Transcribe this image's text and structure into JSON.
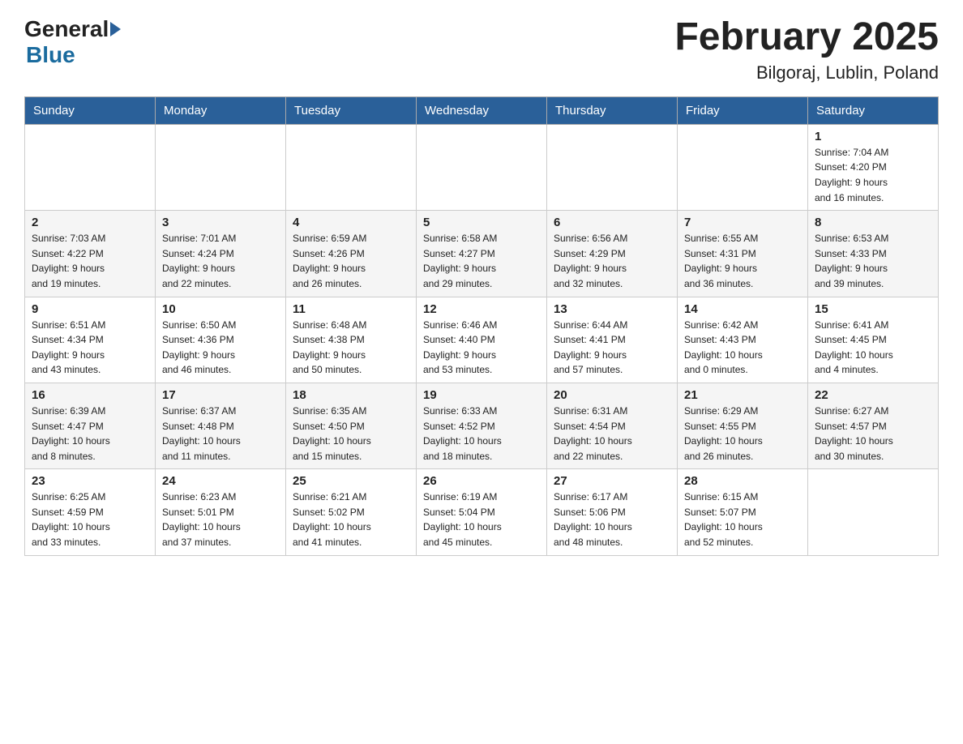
{
  "header": {
    "logo_general": "General",
    "logo_blue": "Blue",
    "title": "February 2025",
    "subtitle": "Bilgoraj, Lublin, Poland"
  },
  "days_of_week": [
    "Sunday",
    "Monday",
    "Tuesday",
    "Wednesday",
    "Thursday",
    "Friday",
    "Saturday"
  ],
  "weeks": [
    {
      "days": [
        {
          "number": "",
          "info": ""
        },
        {
          "number": "",
          "info": ""
        },
        {
          "number": "",
          "info": ""
        },
        {
          "number": "",
          "info": ""
        },
        {
          "number": "",
          "info": ""
        },
        {
          "number": "",
          "info": ""
        },
        {
          "number": "1",
          "info": "Sunrise: 7:04 AM\nSunset: 4:20 PM\nDaylight: 9 hours\nand 16 minutes."
        }
      ]
    },
    {
      "days": [
        {
          "number": "2",
          "info": "Sunrise: 7:03 AM\nSunset: 4:22 PM\nDaylight: 9 hours\nand 19 minutes."
        },
        {
          "number": "3",
          "info": "Sunrise: 7:01 AM\nSunset: 4:24 PM\nDaylight: 9 hours\nand 22 minutes."
        },
        {
          "number": "4",
          "info": "Sunrise: 6:59 AM\nSunset: 4:26 PM\nDaylight: 9 hours\nand 26 minutes."
        },
        {
          "number": "5",
          "info": "Sunrise: 6:58 AM\nSunset: 4:27 PM\nDaylight: 9 hours\nand 29 minutes."
        },
        {
          "number": "6",
          "info": "Sunrise: 6:56 AM\nSunset: 4:29 PM\nDaylight: 9 hours\nand 32 minutes."
        },
        {
          "number": "7",
          "info": "Sunrise: 6:55 AM\nSunset: 4:31 PM\nDaylight: 9 hours\nand 36 minutes."
        },
        {
          "number": "8",
          "info": "Sunrise: 6:53 AM\nSunset: 4:33 PM\nDaylight: 9 hours\nand 39 minutes."
        }
      ]
    },
    {
      "days": [
        {
          "number": "9",
          "info": "Sunrise: 6:51 AM\nSunset: 4:34 PM\nDaylight: 9 hours\nand 43 minutes."
        },
        {
          "number": "10",
          "info": "Sunrise: 6:50 AM\nSunset: 4:36 PM\nDaylight: 9 hours\nand 46 minutes."
        },
        {
          "number": "11",
          "info": "Sunrise: 6:48 AM\nSunset: 4:38 PM\nDaylight: 9 hours\nand 50 minutes."
        },
        {
          "number": "12",
          "info": "Sunrise: 6:46 AM\nSunset: 4:40 PM\nDaylight: 9 hours\nand 53 minutes."
        },
        {
          "number": "13",
          "info": "Sunrise: 6:44 AM\nSunset: 4:41 PM\nDaylight: 9 hours\nand 57 minutes."
        },
        {
          "number": "14",
          "info": "Sunrise: 6:42 AM\nSunset: 4:43 PM\nDaylight: 10 hours\nand 0 minutes."
        },
        {
          "number": "15",
          "info": "Sunrise: 6:41 AM\nSunset: 4:45 PM\nDaylight: 10 hours\nand 4 minutes."
        }
      ]
    },
    {
      "days": [
        {
          "number": "16",
          "info": "Sunrise: 6:39 AM\nSunset: 4:47 PM\nDaylight: 10 hours\nand 8 minutes."
        },
        {
          "number": "17",
          "info": "Sunrise: 6:37 AM\nSunset: 4:48 PM\nDaylight: 10 hours\nand 11 minutes."
        },
        {
          "number": "18",
          "info": "Sunrise: 6:35 AM\nSunset: 4:50 PM\nDaylight: 10 hours\nand 15 minutes."
        },
        {
          "number": "19",
          "info": "Sunrise: 6:33 AM\nSunset: 4:52 PM\nDaylight: 10 hours\nand 18 minutes."
        },
        {
          "number": "20",
          "info": "Sunrise: 6:31 AM\nSunset: 4:54 PM\nDaylight: 10 hours\nand 22 minutes."
        },
        {
          "number": "21",
          "info": "Sunrise: 6:29 AM\nSunset: 4:55 PM\nDaylight: 10 hours\nand 26 minutes."
        },
        {
          "number": "22",
          "info": "Sunrise: 6:27 AM\nSunset: 4:57 PM\nDaylight: 10 hours\nand 30 minutes."
        }
      ]
    },
    {
      "days": [
        {
          "number": "23",
          "info": "Sunrise: 6:25 AM\nSunset: 4:59 PM\nDaylight: 10 hours\nand 33 minutes."
        },
        {
          "number": "24",
          "info": "Sunrise: 6:23 AM\nSunset: 5:01 PM\nDaylight: 10 hours\nand 37 minutes."
        },
        {
          "number": "25",
          "info": "Sunrise: 6:21 AM\nSunset: 5:02 PM\nDaylight: 10 hours\nand 41 minutes."
        },
        {
          "number": "26",
          "info": "Sunrise: 6:19 AM\nSunset: 5:04 PM\nDaylight: 10 hours\nand 45 minutes."
        },
        {
          "number": "27",
          "info": "Sunrise: 6:17 AM\nSunset: 5:06 PM\nDaylight: 10 hours\nand 48 minutes."
        },
        {
          "number": "28",
          "info": "Sunrise: 6:15 AM\nSunset: 5:07 PM\nDaylight: 10 hours\nand 52 minutes."
        },
        {
          "number": "",
          "info": ""
        }
      ]
    }
  ]
}
